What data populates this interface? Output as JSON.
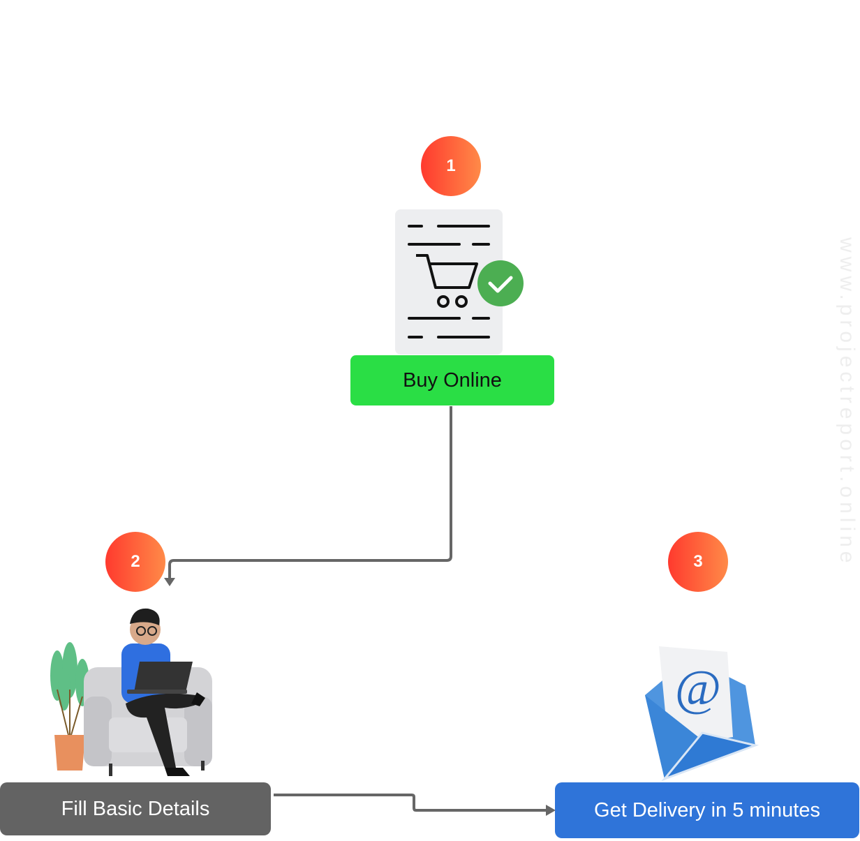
{
  "steps": [
    {
      "number": "1",
      "label": "Buy Online",
      "color": "#2ade45",
      "icon": "shopping-cart-document-icon"
    },
    {
      "number": "2",
      "label": "Fill Basic Details",
      "color": "#636363",
      "icon": "person-laptop-armchair-illustration"
    },
    {
      "number": "3",
      "label": "Get Delivery in 5 minutes",
      "color": "#2f74d9",
      "icon": "email-envelope-icon"
    }
  ],
  "connectors": [
    {
      "from": "1",
      "to": "2"
    },
    {
      "from": "2",
      "to": "3"
    }
  ],
  "watermark": "www.projectreport.online"
}
